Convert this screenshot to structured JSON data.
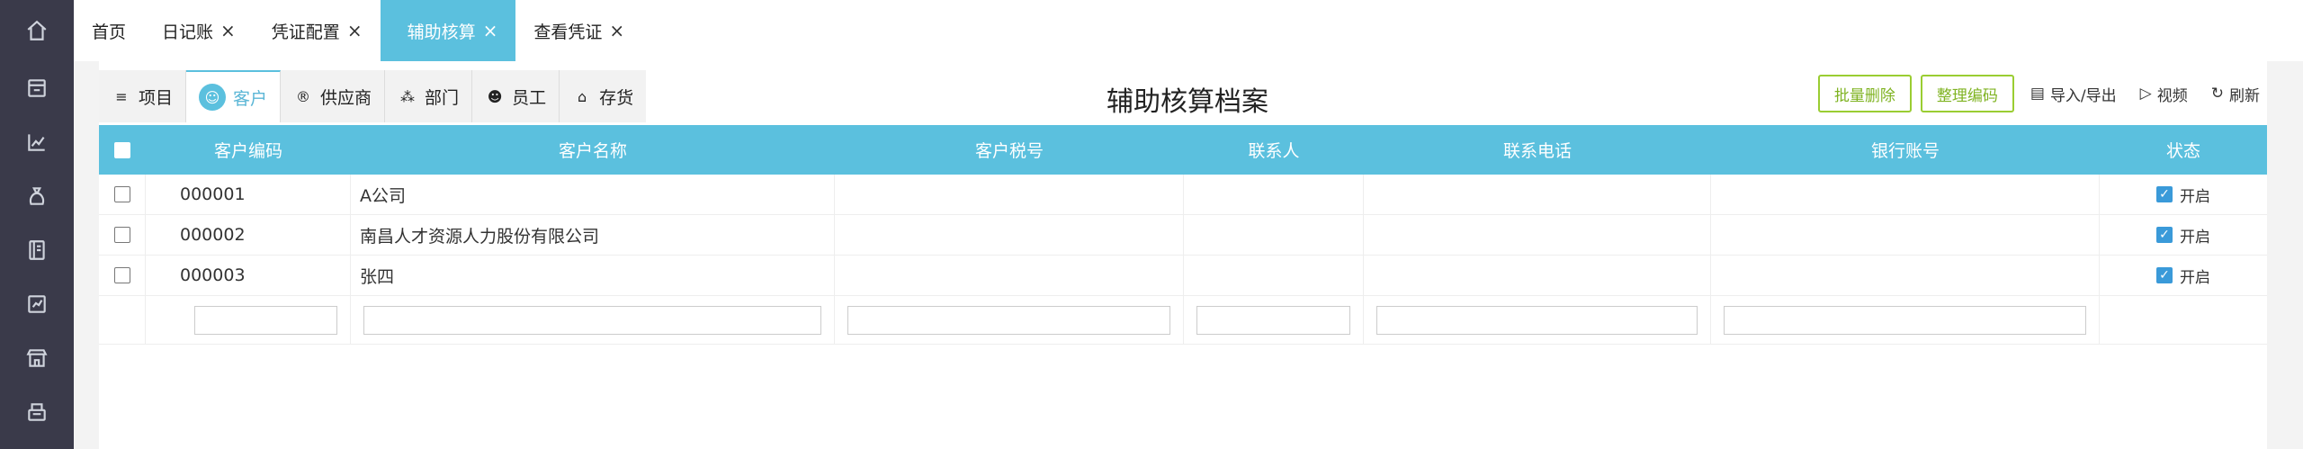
{
  "sidebar": {
    "icons": [
      "home-icon",
      "voucher-icon",
      "chart-icon",
      "money-bag-icon",
      "ledger-icon",
      "report-icon",
      "store-icon",
      "cash-register-icon"
    ]
  },
  "tabs": [
    {
      "label": "首页",
      "closable": false
    },
    {
      "label": "日记账",
      "closable": true
    },
    {
      "label": "凭证配置",
      "closable": true
    },
    {
      "label": "辅助核算",
      "closable": true,
      "active": true
    },
    {
      "label": "查看凭证",
      "closable": true
    }
  ],
  "close_glyph": "×",
  "type_tabs": [
    {
      "label": "项目",
      "icon": "list-icon",
      "glyph": "≡"
    },
    {
      "label": "客户",
      "icon": "user-icon",
      "glyph": "☺",
      "active": true
    },
    {
      "label": "供应商",
      "icon": "supplier-icon",
      "glyph": "®"
    },
    {
      "label": "部门",
      "icon": "org-icon",
      "glyph": "⁂"
    },
    {
      "label": "员工",
      "icon": "badge-icon",
      "glyph": "☻"
    },
    {
      "label": "存货",
      "icon": "house-icon",
      "glyph": "⌂"
    }
  ],
  "page_title": "辅助核算档案",
  "actions": {
    "batch_delete": "批量删除",
    "sort_codes": "整理编码",
    "import_export": "导入/导出",
    "video": "视频",
    "refresh": "刷新"
  },
  "table": {
    "columns": [
      "客户编码",
      "客户名称",
      "客户税号",
      "联系人",
      "联系电话",
      "银行账号",
      "状态"
    ],
    "rows": [
      {
        "code": "000001",
        "name": "A公司",
        "tax_no": "",
        "contact": "",
        "phone": "",
        "bank": "",
        "status": "开启",
        "enabled": true
      },
      {
        "code": "000002",
        "name": "南昌人才资源人力股份有限公司",
        "tax_no": "",
        "contact": "",
        "phone": "",
        "bank": "",
        "status": "开启",
        "enabled": true
      },
      {
        "code": "000003",
        "name": "张四",
        "tax_no": "",
        "contact": "",
        "phone": "",
        "bank": "",
        "status": "开启",
        "enabled": true
      }
    ]
  },
  "colors": {
    "accent": "#5bc0de",
    "sidebar": "#3a3a4a",
    "green_button": "#9acd32",
    "check": "#3a9ad9"
  }
}
